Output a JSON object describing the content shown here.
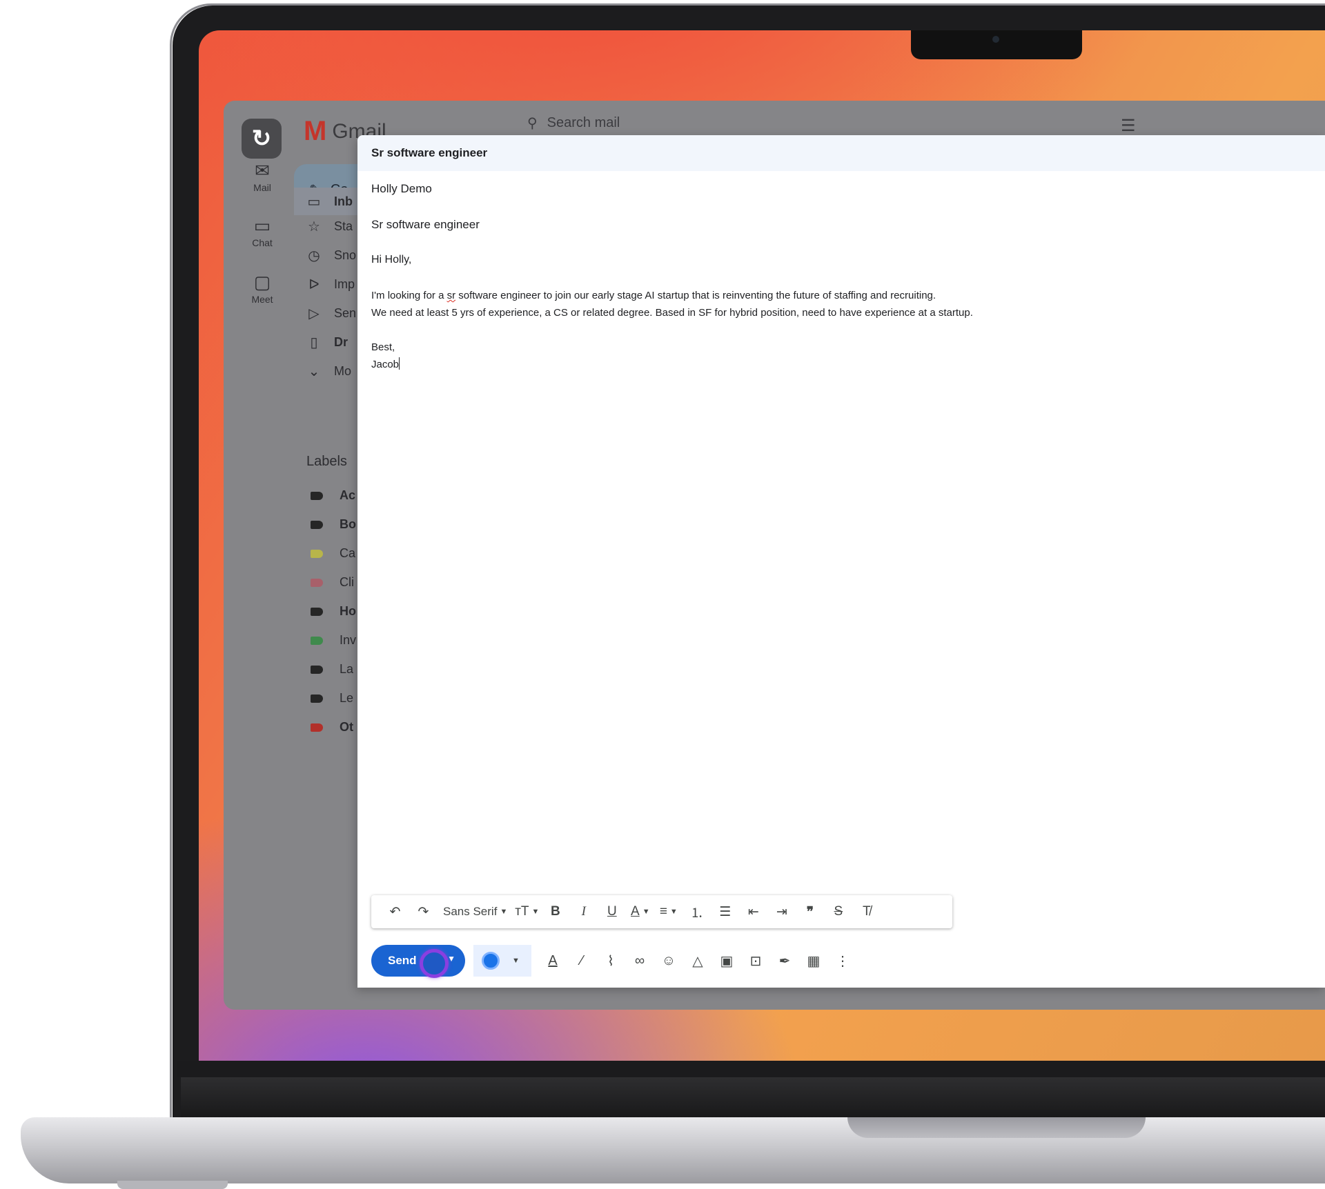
{
  "app": {
    "name": "Gmail",
    "search_placeholder": "Search mail"
  },
  "rail": {
    "items": [
      {
        "label": "Mail",
        "icon": "mail-icon"
      },
      {
        "label": "Chat",
        "icon": "chat-icon"
      },
      {
        "label": "Meet",
        "icon": "video-icon"
      }
    ]
  },
  "sidebar": {
    "compose_label": "Co",
    "nav": [
      {
        "label": "Inb",
        "icon": "inbox-icon",
        "active": true
      },
      {
        "label": "Sta",
        "icon": "star-icon"
      },
      {
        "label": "Sno",
        "icon": "clock-icon"
      },
      {
        "label": "Imp",
        "icon": "important-icon"
      },
      {
        "label": "Sen",
        "icon": "send-icon"
      },
      {
        "label": "Dr",
        "icon": "draft-icon"
      },
      {
        "label": "Mo",
        "icon": "chevron-down-icon"
      }
    ],
    "labels_title": "Labels",
    "labels": [
      {
        "label": "Ac",
        "color": "#262626"
      },
      {
        "label": "Bo",
        "color": "#262626"
      },
      {
        "label": "Ca",
        "color": "#b8b54a"
      },
      {
        "label": "Cli",
        "color": "#a8606a"
      },
      {
        "label": "Ho",
        "color": "#262626"
      },
      {
        "label": "Inv",
        "color": "#3f8a4c"
      },
      {
        "label": "La",
        "color": "#262626"
      },
      {
        "label": "Le",
        "color": "#262626"
      },
      {
        "label": "Ot",
        "color": "#b2302a"
      }
    ]
  },
  "compose": {
    "window_title": "Sr software engineer",
    "to": "Holly Demo",
    "subject": "Sr software engineer",
    "greeting": "Hi Holly,",
    "line1_pre": "I'm looking for a ",
    "line1_misspelled": "sr",
    "line1_post": " software engineer to join our early stage AI startup that is reinventing the future of staffing and recruiting.",
    "line2": "We need at least 5 yrs of experience, a CS or related degree. Based in SF for hybrid position, need to have experience at a startup.",
    "signoff": "Best,",
    "signature": "Jacob",
    "font_name": "Sans Serif",
    "send_label": "Send"
  },
  "colors": {
    "send_button": "#1a64d2",
    "click_indicator": "#8a3fe0"
  }
}
